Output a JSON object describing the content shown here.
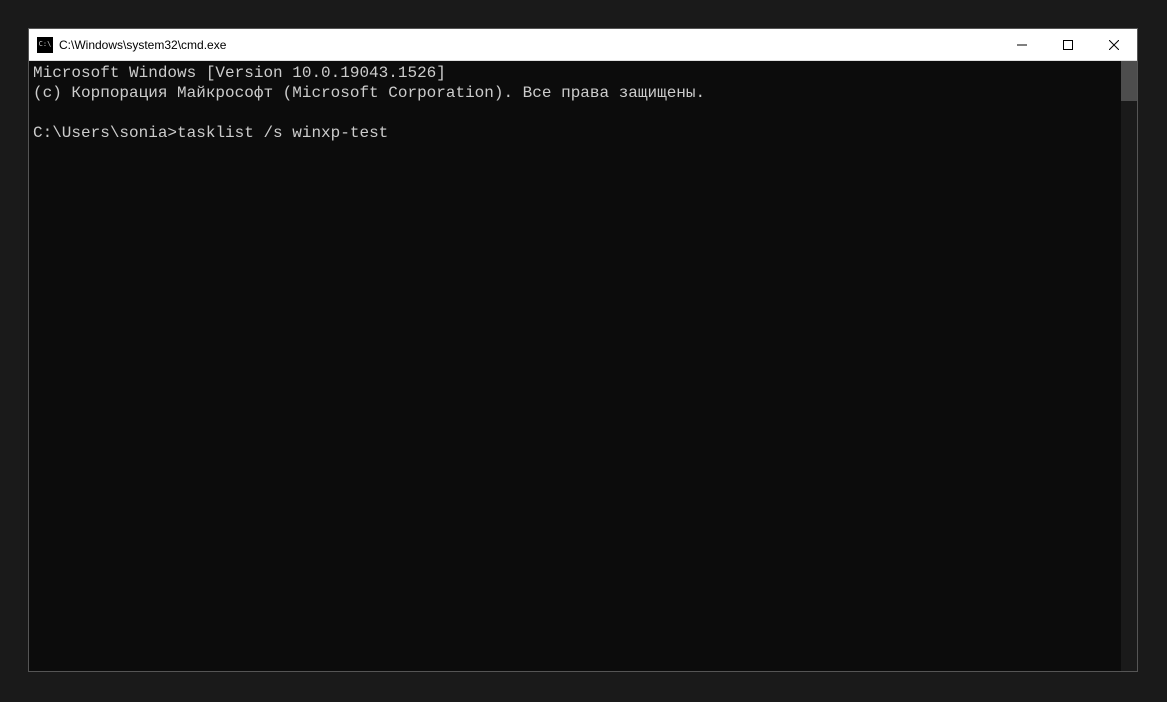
{
  "window": {
    "title": "C:\\Windows\\system32\\cmd.exe",
    "icon_label": "C:\\"
  },
  "terminal": {
    "line1": "Microsoft Windows [Version 10.0.19043.1526]",
    "line2": "(c) Корпорация Майкрософт (Microsoft Corporation). Все права защищены.",
    "blank": "",
    "prompt": "C:\\Users\\sonia>",
    "command": "tasklist /s winxp-test"
  },
  "controls": {
    "minimize": "minimize",
    "maximize": "maximize",
    "close": "close"
  }
}
